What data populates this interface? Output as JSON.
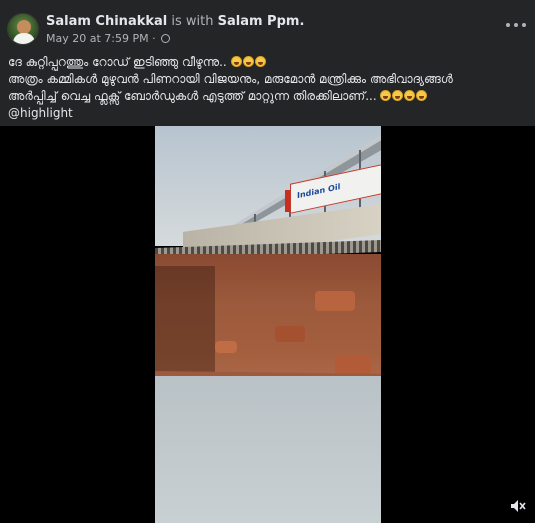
{
  "post": {
    "author": "Salam Chinakkal",
    "is_with_text": "is with",
    "tagged": "Salam Ppm.",
    "date": "May 20 at 7:59 PM",
    "separator": "·",
    "lines": [
      "ദേ കുറ്റിപ്പുറത്തും റോഡ് ഇടിഞ്ഞു വീഴുന്നു..",
      "അത്രം കമ്മികൾ മുഴുവൻ പിണറായി വിജയനും, മരുമോൻ മന്ത്രിക്കും അഭിവാദ്യങ്ങൾ",
      "അർപ്പിച്ച് വെച്ച ഫ്ലക്സ് ബോർഡുകൾ എടുത്ത് മാറ്റുന്ന തിരക്കിലാണ്...",
      "@highlight"
    ]
  },
  "video": {
    "sign_text": "Indian Oil"
  },
  "icons": {
    "globe": "globe-icon",
    "more": "more-options-icon",
    "volume": "volume-mute-icon",
    "emoji": "laughing-emoji-icon"
  },
  "colors": {
    "background": "#242526",
    "text": "#e4e6eb",
    "muted": "#b0b3b8",
    "video_bg": "#000000"
  }
}
